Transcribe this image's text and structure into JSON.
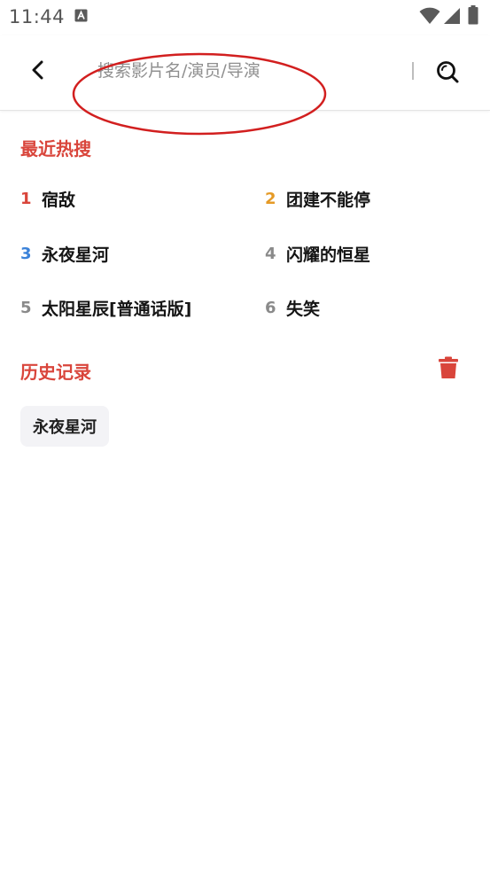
{
  "status_bar": {
    "time": "11:44",
    "icons": [
      "a-notification-icon",
      "wifi-icon",
      "signal-icon",
      "battery-icon"
    ]
  },
  "header": {
    "back_icon": "chevron-left-icon",
    "search_placeholder": "搜索影片名/演员/导演",
    "search_value": "",
    "search_icon": "search-icon"
  },
  "hot_search": {
    "title": "最近热搜",
    "items": [
      {
        "rank": "1",
        "label": "宿敌",
        "rank_color": "#d9453b"
      },
      {
        "rank": "2",
        "label": "团建不能停",
        "rank_color": "#e59a26"
      },
      {
        "rank": "3",
        "label": "永夜星河",
        "rank_color": "#3b82d9"
      },
      {
        "rank": "4",
        "label": "闪耀的恒星",
        "rank_color": "#8a8a8a"
      },
      {
        "rank": "5",
        "label": "太阳星辰[普通话版]",
        "rank_color": "#8a8a8a"
      },
      {
        "rank": "6",
        "label": "失笑",
        "rank_color": "#8a8a8a"
      }
    ]
  },
  "history": {
    "title": "历史记录",
    "clear_icon": "trash-icon",
    "items": [
      "永夜星河"
    ]
  },
  "colors": {
    "accent": "#d9453b",
    "annotation": "#d21f1f",
    "chip_bg": "#f3f3f6"
  }
}
